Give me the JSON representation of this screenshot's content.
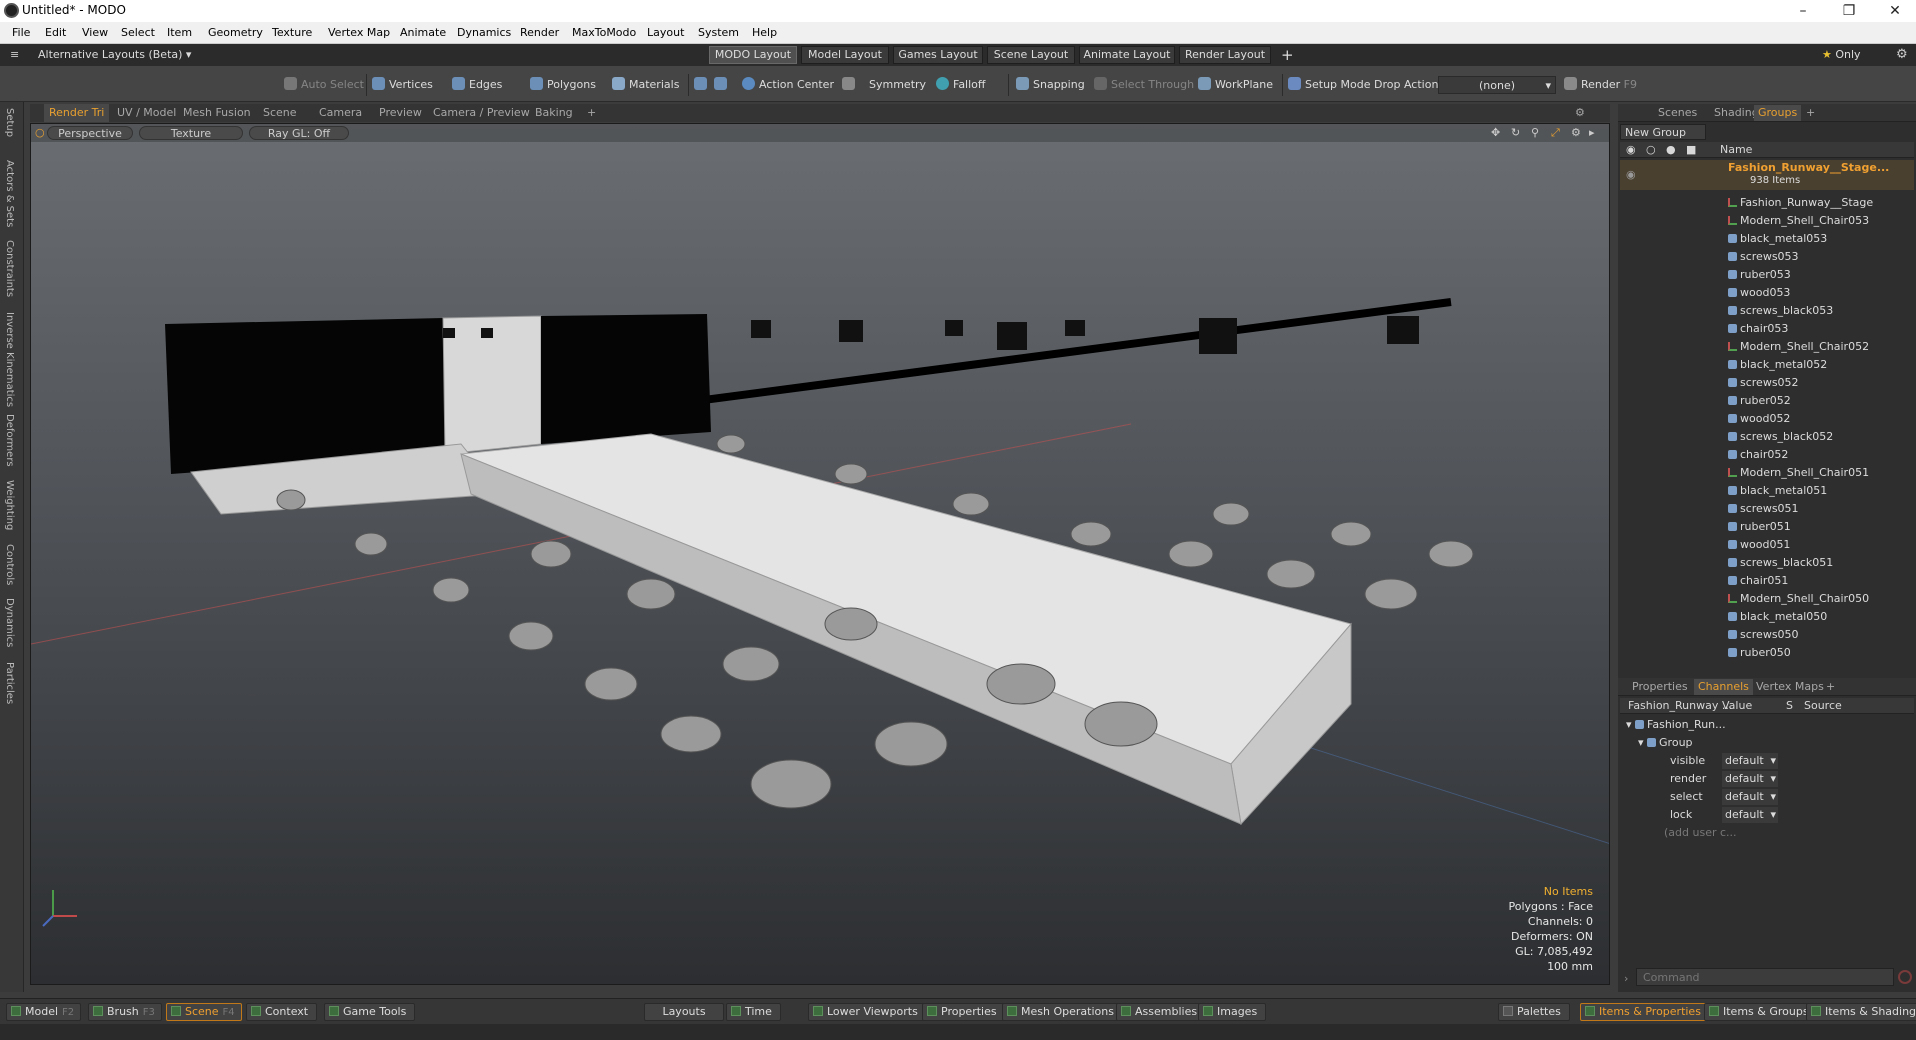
{
  "window": {
    "title": "Untitled* - MODO"
  },
  "menu": [
    "File",
    "Edit",
    "View",
    "Select",
    "Item",
    "Geometry",
    "Texture",
    "Vertex Map",
    "Animate",
    "Dynamics",
    "Render",
    "MaxToModo",
    "Layout",
    "System",
    "Help"
  ],
  "layouts": {
    "alt_label": "Alternative Layouts (Beta)",
    "tabs": [
      "MODO Layout",
      "Model Layout",
      "Games Layout",
      "Scene Layout",
      "Animate Layout",
      "Render Layout"
    ],
    "add": "+",
    "only": "Only"
  },
  "toolbar": {
    "auto_select": "Auto Select",
    "vertices": "Vertices",
    "edges": "Edges",
    "polygons": "Polygons",
    "materials": "Materials",
    "action_center": "Action Center",
    "symmetry": "Symmetry",
    "falloff": "Falloff",
    "snapping": "Snapping",
    "select_through": "Select Through",
    "workplane": "WorkPlane",
    "setup_mode": "Setup Mode",
    "drop_action": "Drop Action",
    "drop_value": "(none)",
    "render": "Render",
    "render_key": "F9"
  },
  "left_tabs": [
    "Setup",
    "Actors & Sets",
    "Constraints",
    "Inverse Kinematics",
    "Deformers",
    "Weighting",
    "Controls",
    "Dynamics",
    "Particles"
  ],
  "viewport_tabs": [
    "Render Tri",
    "UV / Model",
    "Mesh Fusion",
    "Scene",
    "Camera",
    "Preview",
    "Camera / Preview",
    "Baking",
    "+"
  ],
  "viewport": {
    "view": "Perspective",
    "shading": "Texture",
    "raygl": "Ray GL: Off",
    "hud": {
      "no_items": "No Items",
      "polygons": "Polygons : Face",
      "channels": "Channels: 0",
      "deformers": "Deformers: ON",
      "gl": "GL: 7,085,492",
      "scale": "100 mm"
    }
  },
  "scene_panel": {
    "tabs": [
      "Scenes",
      "Shading",
      "Groups",
      "+"
    ],
    "new_group": "New Group",
    "col_name": "Name",
    "group_name": "Fashion_Runway__Stage...",
    "item_count": "938 Items",
    "items": [
      "Fashion_Runway__Stage",
      "Modern_Shell_Chair053",
      "black_metal053",
      "screws053",
      "ruber053",
      "wood053",
      "screws_black053",
      "chair053",
      "Modern_Shell_Chair052",
      "black_metal052",
      "screws052",
      "ruber052",
      "wood052",
      "screws_black052",
      "chair052",
      "Modern_Shell_Chair051",
      "black_metal051",
      "screws051",
      "ruber051",
      "wood051",
      "screws_black051",
      "chair051",
      "Modern_Shell_Chair050",
      "black_metal050",
      "screws050",
      "ruber050"
    ]
  },
  "props_panel": {
    "tabs": [
      "Properties",
      "Channels",
      "Vertex Maps",
      "+"
    ],
    "cols": [
      "Fashion_Runway ...",
      "Value",
      "S",
      "Source"
    ],
    "tree_root": "Fashion_Run...",
    "tree_group": "Group",
    "channels": [
      {
        "name": "visible",
        "value": "default"
      },
      {
        "name": "render",
        "value": "default"
      },
      {
        "name": "select",
        "value": "default"
      },
      {
        "name": "lock",
        "value": "default"
      }
    ],
    "add_user": "(add user c..."
  },
  "command": {
    "placeholder": "Command"
  },
  "statusbar": {
    "model": "Model",
    "model_key": "F2",
    "brush": "Brush",
    "brush_key": "F3",
    "scene": "Scene",
    "scene_key": "F4",
    "context": "Context",
    "game_tools": "Game Tools",
    "layouts": "Layouts",
    "time": "Time",
    "lower_viewports": "Lower Viewports",
    "properties": "Properties",
    "mesh_ops": "Mesh Operations",
    "assemblies": "Assemblies",
    "images": "Images",
    "palettes": "Palettes",
    "items_props": "Items & Properties",
    "items_groups": "Items & Groups",
    "items_shading": "Items & Shading"
  },
  "colors": {
    "accent": "#e8a030",
    "panel": "#2e2e2e"
  }
}
